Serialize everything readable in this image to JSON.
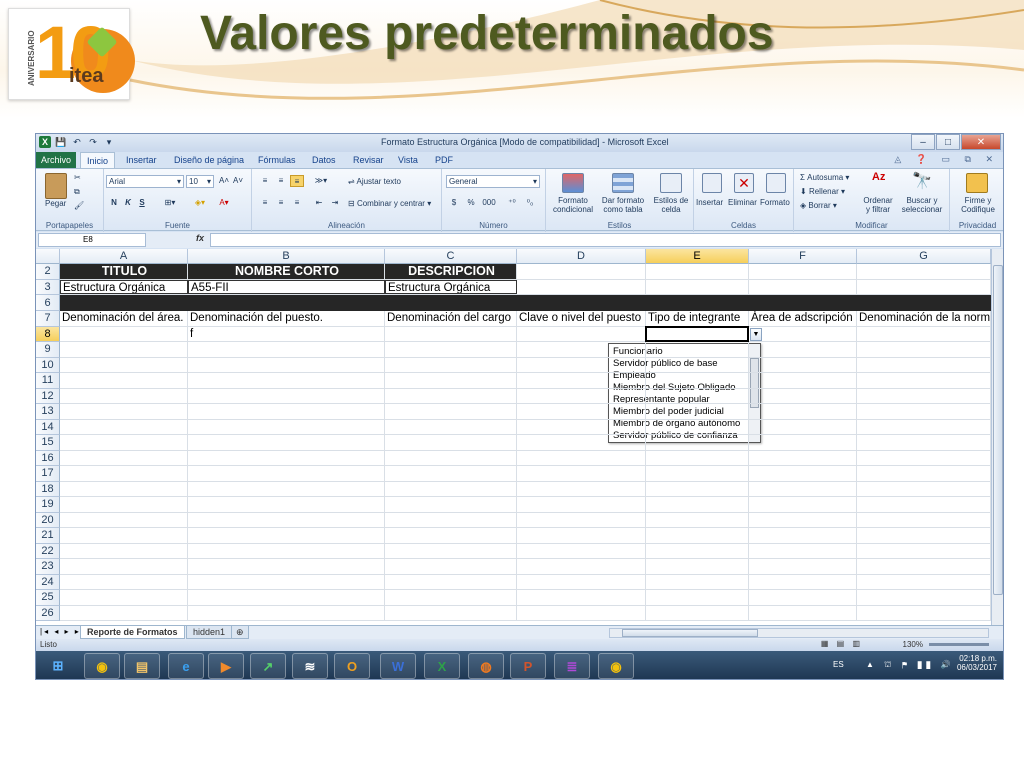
{
  "slide": {
    "title": "Valores predeterminados",
    "logo": {
      "digits": "10",
      "brand": "itea",
      "side_text": "ANIVERSARIO"
    }
  },
  "window": {
    "title": "Formato Estructura Orgánica  [Modo de compatibilidad]  -  Microsoft Excel",
    "buttons": {
      "minimize": "–",
      "maximize": "□",
      "close": "✕"
    }
  },
  "tabs": [
    "Archivo",
    "Inicio",
    "Insertar",
    "Diseño de página",
    "Fórmulas",
    "Datos",
    "Revisar",
    "Vista",
    "PDF"
  ],
  "ribbon": {
    "portapapeles": {
      "paste": "Pegar",
      "label": "Portapapeles"
    },
    "fuente": {
      "font": "Arial",
      "size": "10",
      "bold": "N",
      "italic": "K",
      "underline": "S",
      "label": "Fuente"
    },
    "alineacion": {
      "wrap": "Ajustar texto",
      "merge": "Combinar y centrar",
      "label": "Alineación"
    },
    "numero": {
      "format": "General",
      "currency": "$",
      "percent": "%",
      "thousands": "000",
      "label": "Número"
    },
    "estilos": {
      "cond1": "Formato",
      "cond2": "condicional",
      "table1": "Dar formato",
      "table2": "como tabla",
      "cell1": "Estilos de",
      "cell2": "celda",
      "label": "Estilos"
    },
    "celdas": {
      "insert": "Insertar",
      "delete": "Eliminar",
      "format": "Formato",
      "label": "Celdas"
    },
    "modificar": {
      "autosum": "Autosuma",
      "fill": "Rellenar",
      "clear": "Borrar",
      "sort1": "Ordenar",
      "sort2": "y filtrar",
      "find1": "Buscar y",
      "find2": "seleccionar",
      "label": "Modificar"
    },
    "privacidad": {
      "sign1": "Firme y",
      "sign2": "Codifique",
      "label": "Privacidad"
    }
  },
  "formula_bar": {
    "name_box": "E8",
    "fx": "fx",
    "value": ""
  },
  "columns": [
    "A",
    "B",
    "C",
    "D",
    "E",
    "F",
    "G"
  ],
  "selected_column": "E",
  "rows": [
    "2",
    "3",
    "6",
    "7",
    "8",
    "9",
    "10",
    "11",
    "12",
    "13",
    "14",
    "15",
    "16",
    "17",
    "18",
    "19",
    "20",
    "21",
    "22",
    "23",
    "24",
    "25",
    "26"
  ],
  "selected_row": "8",
  "cells": {
    "r2": [
      "TITULO",
      "NOMBRE CORTO",
      "DESCRIPCION"
    ],
    "r3": [
      "Estructura Orgánica",
      "A55-FII",
      "Estructura Orgánica"
    ],
    "r7": [
      "Denominación del área.",
      "Denominación del puesto.",
      "Denominación del cargo",
      "Clave o nivel del puesto",
      "Tipo de integrante",
      "Área de adscripción",
      "Denominación de la norm"
    ],
    "r8": [
      "",
      "f",
      "",
      "",
      "",
      "",
      ""
    ]
  },
  "dropdown": {
    "options": [
      "Funcionario",
      "Servidor público de base",
      "Empleado",
      "Miembro del Sujeto Obligado",
      "Representante popular",
      "Miembro del poder judicial",
      "Miembro de órgano autónomo",
      "Servidor público de confianza"
    ]
  },
  "sheets": [
    "Reporte de Formatos",
    "hidden1"
  ],
  "status": {
    "ready": "Listo",
    "zoom": "130%"
  },
  "taskbar": {
    "apps": [
      "windows-start",
      "chrome",
      "file-explorer",
      "internet-explorer",
      "media-player",
      "stock-app",
      "wifi-app",
      "outlook",
      "word",
      "excel",
      "firefox",
      "powerpoint",
      "winrar",
      "chrome"
    ],
    "lang": "ES",
    "time": "02:18 p.m.",
    "date": "06/03/2017"
  }
}
